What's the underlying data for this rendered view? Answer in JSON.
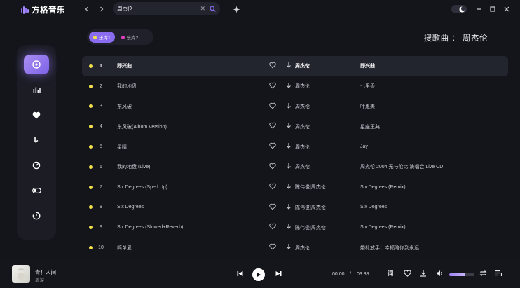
{
  "app": {
    "name": "方格音乐"
  },
  "search": {
    "query": "周杰伦",
    "clear_icon": "close-icon"
  },
  "theme": {
    "accent": "#8a6cf0"
  },
  "libraries": [
    {
      "label": "乐库1",
      "dot_color": "#f2e14c",
      "active": true
    },
    {
      "label": "乐库2",
      "dot_color": "#e040c0",
      "active": false
    }
  ],
  "page_title": "搜歌曲 ： 周杰伦",
  "sidebar": {
    "items": [
      {
        "icon": "disc-icon",
        "active": true
      },
      {
        "icon": "bar-chart-icon",
        "active": false
      },
      {
        "icon": "heart-icon",
        "active": false
      },
      {
        "icon": "music-note-icon",
        "active": false
      },
      {
        "icon": "dial-icon",
        "active": false
      },
      {
        "icon": "toggle-icon",
        "active": false
      },
      {
        "icon": "timer-icon",
        "active": false
      }
    ]
  },
  "songs": [
    {
      "num": "1",
      "title": "即兴曲",
      "artist": "周杰伦",
      "album": "即兴曲"
    },
    {
      "num": "2",
      "title": "我的地盘",
      "artist": "周杰伦",
      "album": "七里香"
    },
    {
      "num": "3",
      "title": "东风破",
      "artist": "周杰伦",
      "album": "叶惠美"
    },
    {
      "num": "4",
      "title": "东风破(Album Version)",
      "artist": "周杰伦",
      "album": "星座王典"
    },
    {
      "num": "5",
      "title": "星晴",
      "artist": "周杰伦",
      "album": "Jay"
    },
    {
      "num": "6",
      "title": "我的地盘 (Live)",
      "artist": "周杰伦",
      "album": "周杰伦 2004 无与伦比 演唱会 Live CD"
    },
    {
      "num": "7",
      "title": "Six Degrees (Sped Up)",
      "artist": "陈伟俊|周杰伦",
      "album": "Six Degrees (Remix)"
    },
    {
      "num": "8",
      "title": "Six Degrees",
      "artist": "陈伟俊|周杰伦",
      "album": "Six Degrees"
    },
    {
      "num": "9",
      "title": "Six Degrees (Slowed+Reverb)",
      "artist": "陈伟俊|周杰伦",
      "album": "Six Degrees (Remix)"
    },
    {
      "num": "10",
      "title": "简单爱",
      "artist": "周杰伦",
      "album": "婚礼放手：幸福陪你到永远"
    }
  ],
  "player": {
    "title": "青！人间",
    "artist": "周深",
    "current_time": "00:00",
    "separator": "/",
    "total_time": "03:38",
    "lyrics_label": "词",
    "volume": 0.65
  }
}
